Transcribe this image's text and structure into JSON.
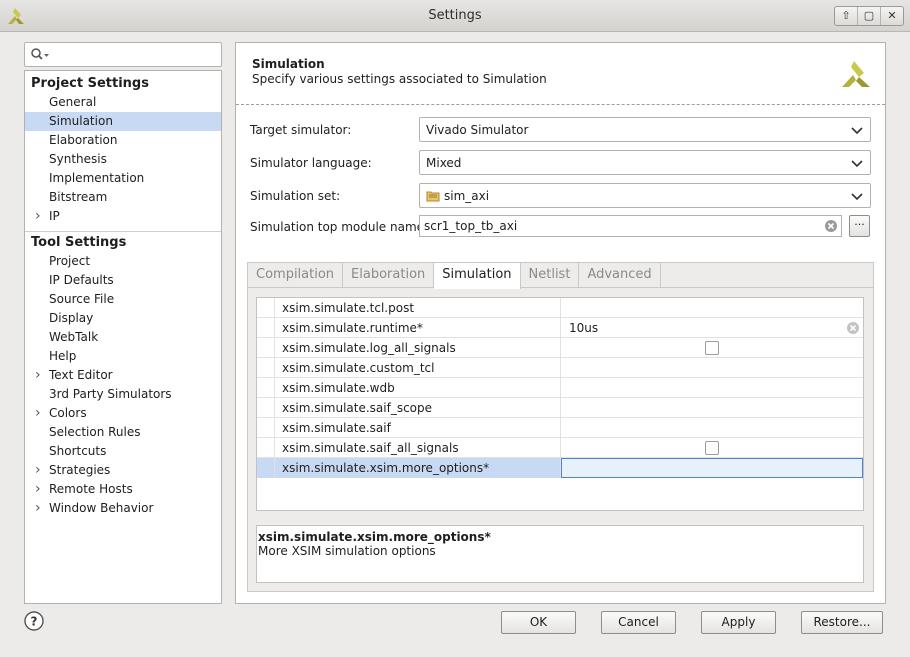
{
  "window": {
    "title": "Settings",
    "controls": [
      "⇧",
      "▢",
      "✕"
    ]
  },
  "search": {
    "placeholder": ""
  },
  "tree": {
    "project_header": "Project Settings",
    "project_items": [
      {
        "label": "General",
        "expandable": false
      },
      {
        "label": "Simulation",
        "expandable": false,
        "selected": true
      },
      {
        "label": "Elaboration",
        "expandable": false
      },
      {
        "label": "Synthesis",
        "expandable": false
      },
      {
        "label": "Implementation",
        "expandable": false
      },
      {
        "label": "Bitstream",
        "expandable": false
      },
      {
        "label": "IP",
        "expandable": true
      }
    ],
    "tool_header": "Tool Settings",
    "tool_items": [
      {
        "label": "Project",
        "expandable": false
      },
      {
        "label": "IP Defaults",
        "expandable": false
      },
      {
        "label": "Source File",
        "expandable": false
      },
      {
        "label": "Display",
        "expandable": false
      },
      {
        "label": "WebTalk",
        "expandable": false
      },
      {
        "label": "Help",
        "expandable": false
      },
      {
        "label": "Text Editor",
        "expandable": true
      },
      {
        "label": "3rd Party Simulators",
        "expandable": false
      },
      {
        "label": "Colors",
        "expandable": true
      },
      {
        "label": "Selection Rules",
        "expandable": false
      },
      {
        "label": "Shortcuts",
        "expandable": false
      },
      {
        "label": "Strategies",
        "expandable": true
      },
      {
        "label": "Remote Hosts",
        "expandable": true
      },
      {
        "label": "Window Behavior",
        "expandable": true
      }
    ]
  },
  "header": {
    "title": "Simulation",
    "subtitle": "Specify various settings associated to Simulation"
  },
  "form": {
    "target_simulator": {
      "label": "Target simulator:",
      "value": "Vivado Simulator"
    },
    "simulator_language": {
      "label": "Simulator language:",
      "value": "Mixed"
    },
    "simulation_set": {
      "label": "Simulation set:",
      "value": "sim_axi"
    },
    "top_module": {
      "label": "Simulation top module name:",
      "value": "scr1_top_tb_axi",
      "browse": "···"
    }
  },
  "tabs": [
    "Compilation",
    "Elaboration",
    "Simulation",
    "Netlist",
    "Advanced"
  ],
  "active_tab": "Simulation",
  "properties": [
    {
      "name": "xsim.simulate.tcl.post",
      "value": "",
      "type": "text"
    },
    {
      "name": "xsim.simulate.runtime*",
      "value": "10us",
      "type": "text"
    },
    {
      "name": "xsim.simulate.log_all_signals",
      "value": "",
      "type": "checkbox"
    },
    {
      "name": "xsim.simulate.custom_tcl",
      "value": "",
      "type": "text"
    },
    {
      "name": "xsim.simulate.wdb",
      "value": "",
      "type": "text"
    },
    {
      "name": "xsim.simulate.saif_scope",
      "value": "",
      "type": "text"
    },
    {
      "name": "xsim.simulate.saif",
      "value": "",
      "type": "text"
    },
    {
      "name": "xsim.simulate.saif_all_signals",
      "value": "",
      "type": "checkbox"
    },
    {
      "name": "xsim.simulate.xsim.more_options*",
      "value": "",
      "type": "text",
      "selected": true
    }
  ],
  "description": {
    "title": "xsim.simulate.xsim.more_options*",
    "text": "More XSIM simulation options"
  },
  "buttons": {
    "ok": "OK",
    "cancel": "Cancel",
    "apply": "Apply",
    "restore": "Restore..."
  },
  "colors": {
    "selection": "#c8d9f3",
    "logo": "#b3b33a"
  }
}
